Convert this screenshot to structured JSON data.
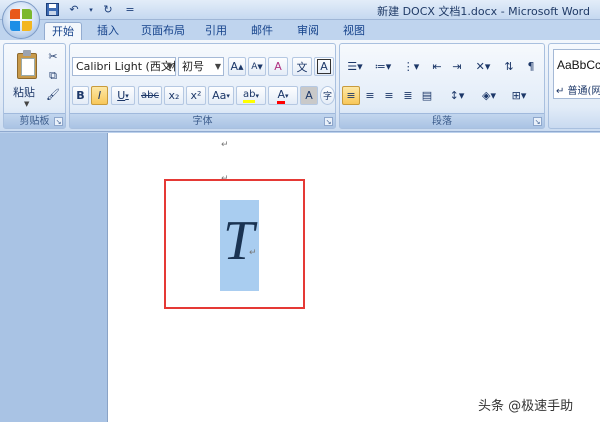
{
  "window": {
    "title": "新建 DOCX 文档1.docx - Microsoft Word"
  },
  "qat": {
    "customize_label": "="
  },
  "tabs": [
    "开始",
    "插入",
    "页面布局",
    "引用",
    "邮件",
    "审阅",
    "视图"
  ],
  "clipboard": {
    "paste_label": "粘贴",
    "group_label": "剪贴板"
  },
  "font": {
    "name_value": "Calibri Light (西文标",
    "size_value": "初号",
    "bold": "B",
    "italic": "I",
    "underline": "U",
    "strike": "abc",
    "subscript": "x₂",
    "superscript": "x²",
    "change_case": "Aa",
    "grow": "A",
    "shrink": "A",
    "clear": "A",
    "phonetic": "文",
    "border_char": "A",
    "highlight": "ab",
    "font_color": "A",
    "shading": "A",
    "enclose": "字",
    "group_label": "字体"
  },
  "paragraph": {
    "group_label": "段落"
  },
  "styles": {
    "sample": "AaBbCcDc",
    "name": "↵ 普通(网"
  },
  "document": {
    "letter": "T",
    "para_mark": "↵"
  },
  "watermark": "头条 @极速手助"
}
